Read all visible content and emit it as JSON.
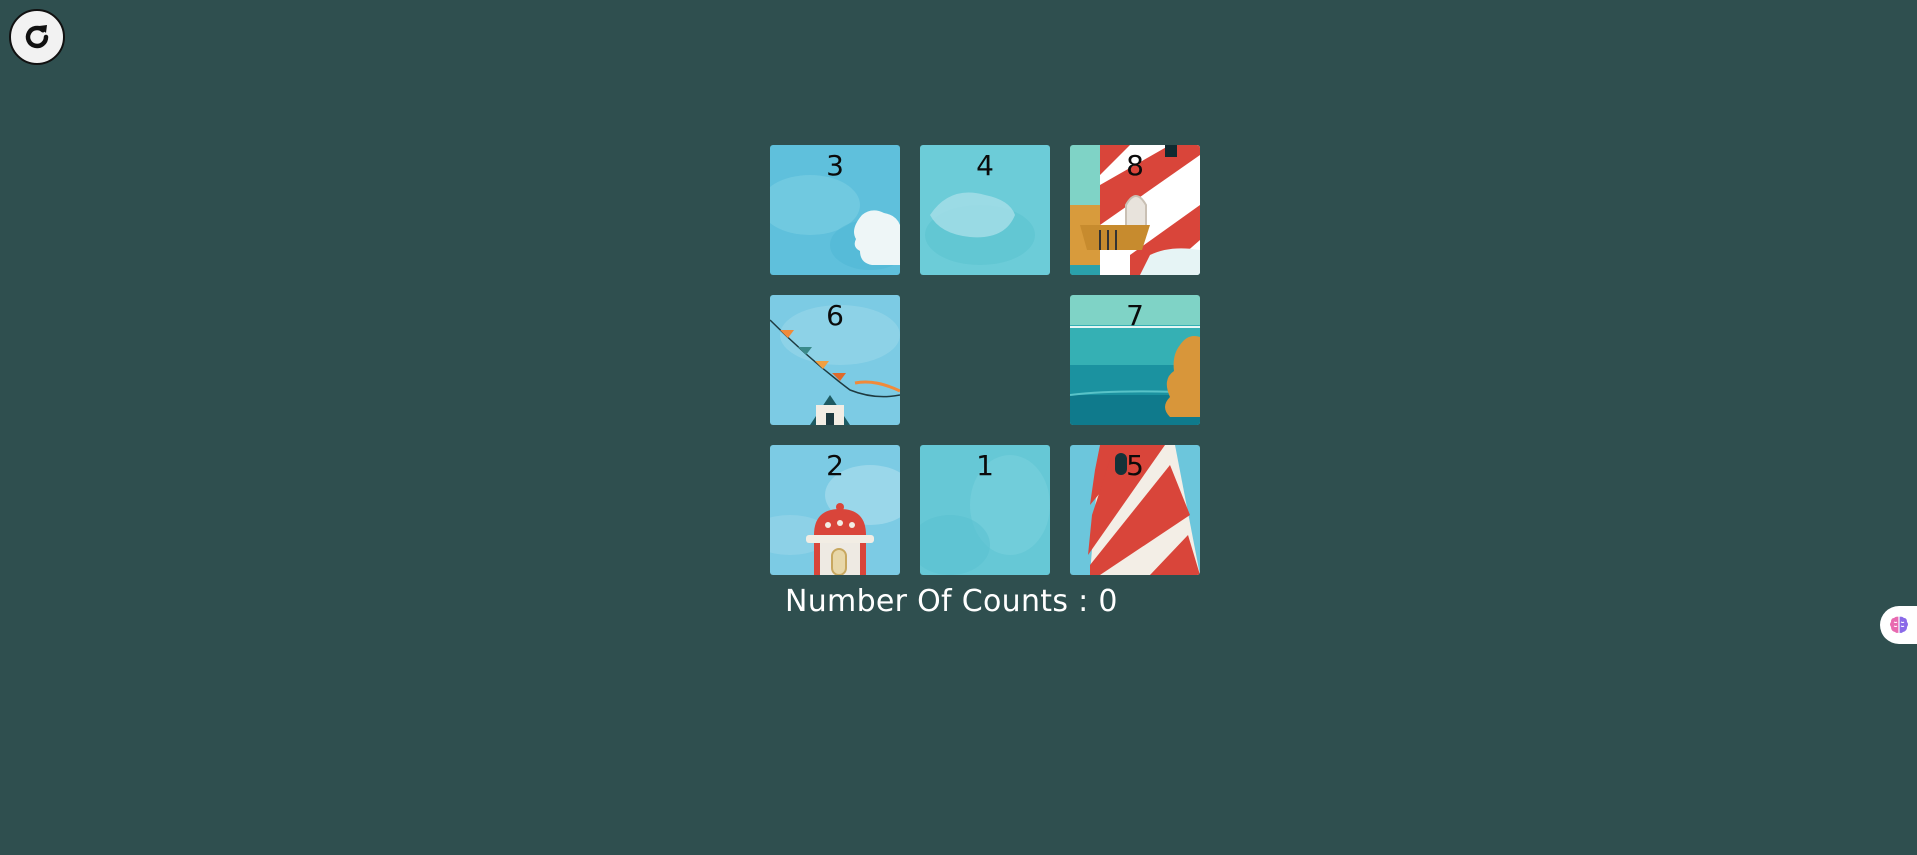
{
  "restart": {
    "icon": "restart-icon"
  },
  "tiles": [
    {
      "label": "3"
    },
    {
      "label": "4"
    },
    {
      "label": "8"
    },
    {
      "label": "6"
    },
    {
      "label": "7"
    },
    {
      "label": "2"
    },
    {
      "label": "1"
    },
    {
      "label": "5"
    }
  ],
  "counter": {
    "text": "Number Of Counts : 0"
  },
  "extension": {
    "icon": "brain-icon"
  },
  "colors": {
    "background": "#2f4f4f",
    "sky": "#6fc6dc",
    "sea": "#1f8a9a",
    "lighthouse_red": "#d9453a"
  }
}
